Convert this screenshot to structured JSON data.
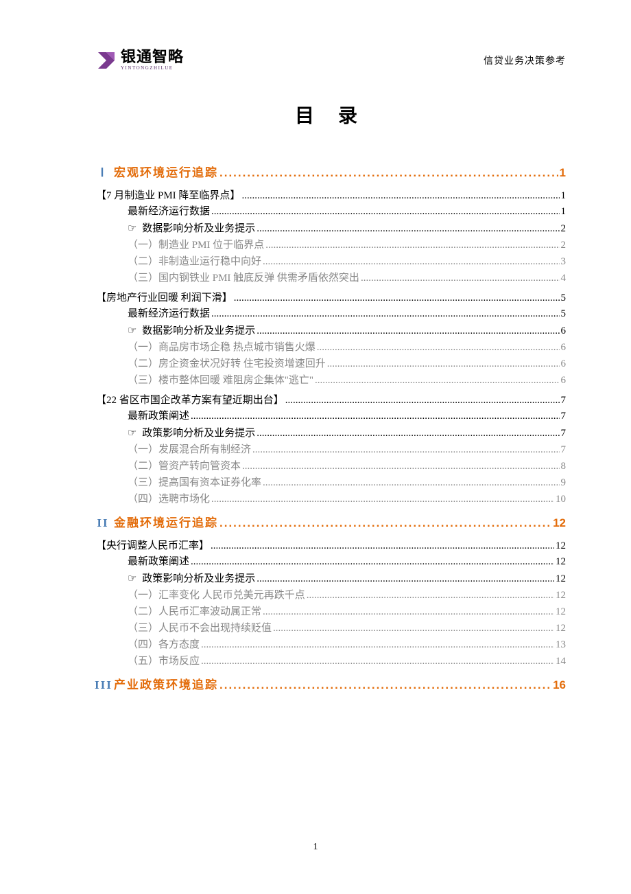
{
  "header": {
    "logo_cn": "银通智略",
    "logo_en": "YINTONGZHILUE",
    "right": "信贷业务决策参考"
  },
  "title": "目  录",
  "page_number": "1",
  "sections": [
    {
      "num": "Ⅰ",
      "label": "宏观环境运行追踪",
      "page": "1",
      "groups": [
        {
          "title": "【7 月制造业 PMI 降至临界点】",
          "page": "1",
          "items": [
            {
              "type": "data",
              "label": "最新经济运行数据",
              "page": "1"
            },
            {
              "type": "analysis",
              "label": "数据影响分析及业务提示",
              "page": "2"
            },
            {
              "type": "sub",
              "label": "（一）制造业 PMI 位于临界点",
              "page": "2"
            },
            {
              "type": "sub",
              "label": "（二）非制造业运行稳中向好",
              "page": "3"
            },
            {
              "type": "sub",
              "label": "（三）国内钢铁业 PMI 触底反弹  供需矛盾依然突出",
              "page": "4"
            }
          ]
        },
        {
          "title": "【房地产行业回暖  利润下滑】",
          "page": "5",
          "items": [
            {
              "type": "data",
              "label": "最新经济运行数据",
              "page": "5"
            },
            {
              "type": "analysis",
              "label": "数据影响分析及业务提示",
              "page": "6"
            },
            {
              "type": "sub",
              "label": "（一）商品房市场企稳  热点城市销售火爆",
              "page": "6"
            },
            {
              "type": "sub",
              "label": "（二）房企资金状况好转  住宅投资增速回升",
              "page": "6"
            },
            {
              "type": "sub",
              "label": "（三）楼市整体回暖 难阻房企集体\"逃亡\"",
              "page": "6"
            }
          ]
        },
        {
          "title": "【22 省区市国企改革方案有望近期出台】",
          "page": "7",
          "items": [
            {
              "type": "data",
              "label": "最新政策阐述",
              "page": "7"
            },
            {
              "type": "analysis",
              "label": "政策影响分析及业务提示",
              "page": "7"
            },
            {
              "type": "sub",
              "label": "（一）发展混合所有制经济",
              "page": "7"
            },
            {
              "type": "sub",
              "label": "（二）管资产转向管资本",
              "page": "8"
            },
            {
              "type": "sub",
              "label": "（三）提高国有资本证券化率",
              "page": "9"
            },
            {
              "type": "sub",
              "label": "（四）选聘市场化",
              "page": "10"
            }
          ]
        }
      ]
    },
    {
      "num": "II",
      "label": "金融环境运行追踪",
      "page": "12",
      "groups": [
        {
          "title": "【央行调整人民币汇率】",
          "page": "12",
          "items": [
            {
              "type": "data",
              "label": "最新政策阐述",
              "page": "12"
            },
            {
              "type": "analysis",
              "label": "政策影响分析及业务提示",
              "page": "12"
            },
            {
              "type": "sub",
              "label": "（一）汇率变化  人民币兑美元再跌千点",
              "page": "12"
            },
            {
              "type": "sub",
              "label": "（二）人民币汇率波动属正常",
              "page": "12"
            },
            {
              "type": "sub",
              "label": "（三）人民币不会出现持续贬值",
              "page": "12"
            },
            {
              "type": "sub",
              "label": "（四）各方态度",
              "page": "13"
            },
            {
              "type": "sub",
              "label": "（五）市场反应",
              "page": "14"
            }
          ]
        }
      ]
    },
    {
      "num": "III",
      "label": "产业政策环境追踪",
      "page": "16",
      "groups": []
    }
  ]
}
